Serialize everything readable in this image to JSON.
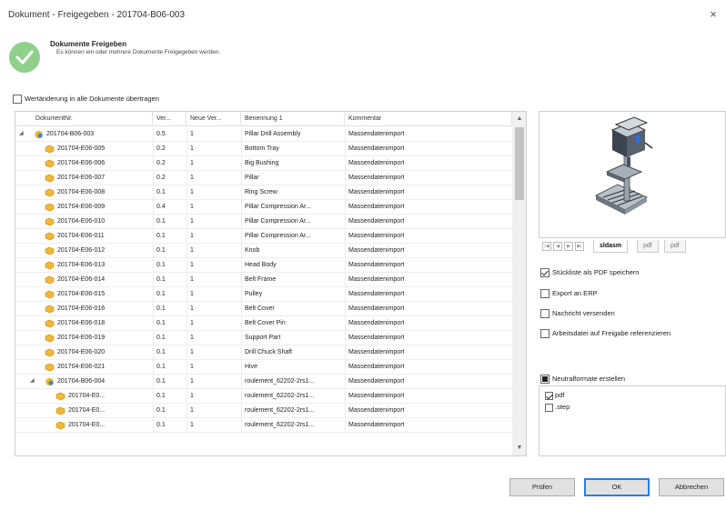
{
  "window": {
    "title": "Dokument - Freigegeben - 201704-B06-003",
    "close_glyph": "×"
  },
  "header": {
    "title": "Dokumente Freigeben",
    "subtitle": "Es können ein oder mehrere Dokumente Freigegeben werden.",
    "icon": "success-check-icon",
    "icon_color": "#8fd18b"
  },
  "propagate_label": "Wertänderung in alle Dokumente übertragen",
  "grid": {
    "columns": [
      "DokumentNr.",
      "Ver...",
      "Neue Ver...",
      "Benennung 1",
      "Kommentar"
    ],
    "rows": [
      {
        "indent": 0,
        "expander": "◢",
        "icon": "assembly-icon",
        "docnr": "201704-B06-003",
        "ver": "0.5",
        "newver": "1",
        "name": "Pillar Drill Assembly",
        "comment": "Massendatenimport"
      },
      {
        "indent": 1,
        "expander": "",
        "icon": "part-icon",
        "docnr": "201704-E06-005",
        "ver": "0.2",
        "newver": "1",
        "name": "Bottom Tray",
        "comment": "Massendatenimport"
      },
      {
        "indent": 1,
        "expander": "",
        "icon": "part-icon",
        "docnr": "201704-E06-006",
        "ver": "0.2",
        "newver": "1",
        "name": "Big Bushing",
        "comment": "Massendatenimport"
      },
      {
        "indent": 1,
        "expander": "",
        "icon": "part-icon",
        "docnr": "201704-E06-007",
        "ver": "0.2",
        "newver": "1",
        "name": "Pillar",
        "comment": "Massendatenimport"
      },
      {
        "indent": 1,
        "expander": "",
        "icon": "part-icon",
        "docnr": "201704-E06-008",
        "ver": "0.1",
        "newver": "1",
        "name": "Ring Screw",
        "comment": "Massendatenimport"
      },
      {
        "indent": 1,
        "expander": "",
        "icon": "part-icon",
        "docnr": "201704-E06-009",
        "ver": "0.4",
        "newver": "1",
        "name": "Pillar Compression Ar...",
        "comment": "Massendatenimport"
      },
      {
        "indent": 1,
        "expander": "",
        "icon": "part-icon",
        "docnr": "201704-E06-010",
        "ver": "0.1",
        "newver": "1",
        "name": "Pillar Compression Ar...",
        "comment": "Massendatenimport"
      },
      {
        "indent": 1,
        "expander": "",
        "icon": "part-icon",
        "docnr": "201704-E06-011",
        "ver": "0.1",
        "newver": "1",
        "name": "Pillar Compression Ar...",
        "comment": "Massendatenimport"
      },
      {
        "indent": 1,
        "expander": "",
        "icon": "part-icon",
        "docnr": "201704-E06-012",
        "ver": "0.1",
        "newver": "1",
        "name": "Knob",
        "comment": "Massendatenimport"
      },
      {
        "indent": 1,
        "expander": "",
        "icon": "part-icon",
        "docnr": "201704-E06-013",
        "ver": "0.1",
        "newver": "1",
        "name": "Head Body",
        "comment": "Massendatenimport"
      },
      {
        "indent": 1,
        "expander": "",
        "icon": "part-icon",
        "docnr": "201704-E06-014",
        "ver": "0.1",
        "newver": "1",
        "name": "Belt Frame",
        "comment": "Massendatenimport"
      },
      {
        "indent": 1,
        "expander": "",
        "icon": "part-icon",
        "docnr": "201704-E06-015",
        "ver": "0.1",
        "newver": "1",
        "name": "Pulley",
        "comment": "Massendatenimport"
      },
      {
        "indent": 1,
        "expander": "",
        "icon": "part-icon",
        "docnr": "201704-E06-016",
        "ver": "0.1",
        "newver": "1",
        "name": "Belt Cover",
        "comment": "Massendatenimport"
      },
      {
        "indent": 1,
        "expander": "",
        "icon": "part-icon",
        "docnr": "201704-E06-018",
        "ver": "0.1",
        "newver": "1",
        "name": "Belt Cover Pin",
        "comment": "Massendatenimport"
      },
      {
        "indent": 1,
        "expander": "",
        "icon": "part-icon",
        "docnr": "201704-E06-019",
        "ver": "0.1",
        "newver": "1",
        "name": "Support Part",
        "comment": "Massendatenimport"
      },
      {
        "indent": 1,
        "expander": "",
        "icon": "part-icon",
        "docnr": "201704-E06-020",
        "ver": "0.1",
        "newver": "1",
        "name": "Drill Chuck Shaft",
        "comment": "Massendatenimport"
      },
      {
        "indent": 1,
        "expander": "",
        "icon": "part-icon",
        "docnr": "201704-E06-021",
        "ver": "0.1",
        "newver": "1",
        "name": "Hive",
        "comment": "Massendatenimport"
      },
      {
        "indent": 1,
        "expander": "◢",
        "icon": "assembly-icon",
        "docnr": "201704-B06-004",
        "ver": "0.1",
        "newver": "1",
        "name": "roulement_62202-2rs1...",
        "comment": "Massendatenimport"
      },
      {
        "indent": 2,
        "expander": "",
        "icon": "part-icon",
        "docnr": "201704-E0...",
        "ver": "0.1",
        "newver": "1",
        "name": "roulement_62202-2rs1...",
        "comment": "Massendatenimport"
      },
      {
        "indent": 2,
        "expander": "",
        "icon": "part-icon",
        "docnr": "201704-E0...",
        "ver": "0.1",
        "newver": "1",
        "name": "roulement_62202-2rs1...",
        "comment": "Massendatenimport"
      },
      {
        "indent": 2,
        "expander": "",
        "icon": "part-icon",
        "docnr": "201704-E0...",
        "ver": "0.1",
        "newver": "1",
        "name": "roulement_62202-2rs1...",
        "comment": "Massendatenimport"
      }
    ]
  },
  "preview": {
    "tabs": [
      "sldasm",
      "pdf",
      "pdf"
    ],
    "active_tab": "sldasm"
  },
  "options": {
    "stueckliste": {
      "label": "Stückliste als PDF speichern",
      "checked": true
    },
    "export_erp": {
      "label": "Export an ERP",
      "checked": false
    },
    "nachricht": {
      "label": "Nachricht versenden",
      "checked": false
    },
    "arbeitsdatei": {
      "label": "Arbeitsdatei auf Freigabe referenzieren",
      "checked": false
    }
  },
  "neutral": {
    "label": "Neutralformate erstellen",
    "formats": [
      {
        "label": "pdf",
        "checked": true
      },
      {
        "label": ".step",
        "checked": false
      }
    ]
  },
  "buttons": {
    "check": "Prüfen",
    "ok": "OK",
    "cancel": "Abbrechen"
  }
}
